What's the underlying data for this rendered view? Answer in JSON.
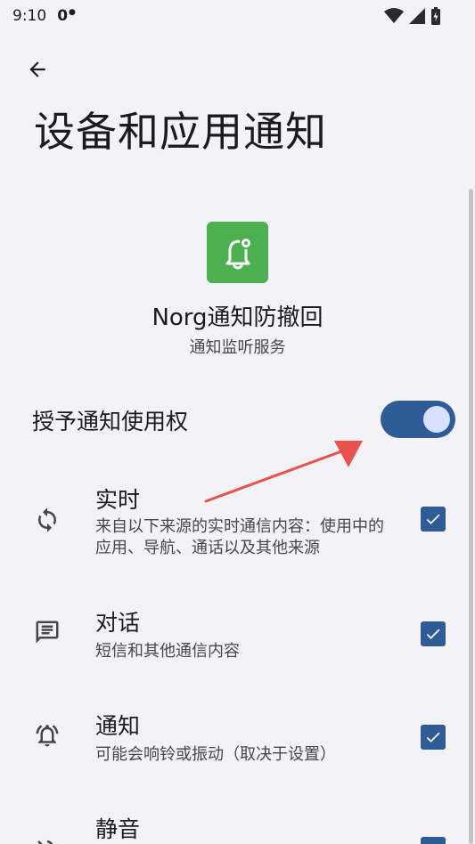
{
  "status_bar": {
    "time": "9:10",
    "extra": "0",
    "icons": [
      "wifi-icon",
      "signal-icon",
      "battery-icon"
    ]
  },
  "header": {
    "back_icon": "arrow-left-icon",
    "title": "设备和应用通知"
  },
  "app": {
    "icon": "bell-gear-icon",
    "icon_color": "#4caf50",
    "name": "Norg通知防撤回",
    "subtitle": "通知监听服务"
  },
  "grant": {
    "label": "授予通知使用权",
    "enabled": true,
    "accent": "#2f5c96"
  },
  "items": [
    {
      "icon": "sync-icon",
      "title": "实时",
      "desc": "来自以下来源的实时通信内容：使用中的应用、导航、通话以及其他来源",
      "checked": true
    },
    {
      "icon": "message-icon",
      "title": "对话",
      "desc": "短信和其他通信内容",
      "checked": true
    },
    {
      "icon": "ringing-bell-icon",
      "title": "通知",
      "desc": "可能会响铃或振动（取决于设置）",
      "checked": true
    },
    {
      "icon": "silent-icon",
      "title": "静音",
      "desc": "",
      "checked": true
    }
  ]
}
